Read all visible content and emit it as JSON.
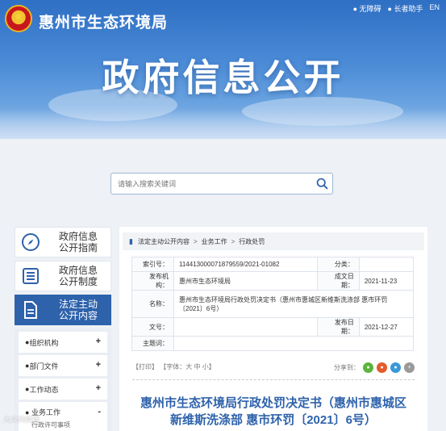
{
  "header": {
    "site_title": "惠州市生态环境局",
    "links": [
      "无障碍",
      "长者助手",
      "EN"
    ],
    "banner_text": "政府信息公开"
  },
  "search": {
    "placeholder": "请输入搜索关键词"
  },
  "left_menu": {
    "items": [
      {
        "label_line1": "政府信息",
        "label_line2": "公开指南",
        "icon": "compass-icon",
        "active": false
      },
      {
        "label_line1": "政府信息",
        "label_line2": "公开制度",
        "icon": "list-icon",
        "active": false
      },
      {
        "label_line1": "法定主动",
        "label_line2": "公开内容",
        "icon": "document-icon",
        "active": true
      }
    ],
    "sub_items": [
      {
        "label": "组织机构",
        "toggle": "+"
      },
      {
        "label": "部门文件",
        "toggle": "+"
      },
      {
        "label": "工作动态",
        "toggle": "+"
      },
      {
        "label": "业务工作",
        "toggle": "-",
        "child": "行政许可事项"
      }
    ]
  },
  "breadcrumb": [
    "法定主动公开内容",
    "业务工作",
    "行政处罚"
  ],
  "info": {
    "index_label": "索引号：",
    "index_value": "114413000071879559/2021-01082",
    "category_label": "分类：",
    "category_value": "",
    "publisher_label": "发布机构：",
    "publisher_value": "惠州市生态环境局",
    "created_label": "成文日期：",
    "created_value": "2021-11-23",
    "name_label": "名称：",
    "name_value": "惠州市生态环境局行政处罚决定书（惠州市惠城区新维斯洗涤部 惠市环罚〔2021〕6号）",
    "docno_label": "文号：",
    "docno_value": "",
    "published_label": "发布日期：",
    "published_value": "2021-12-27",
    "keywords_label": "主题词：",
    "keywords_value": ""
  },
  "tools": {
    "print": "【打印】",
    "font_label": "【字体：",
    "font_large": "大",
    "font_medium": "中",
    "font_small": "小",
    "font_end": "】",
    "share_label": "分享到："
  },
  "document": {
    "title_line1": "惠州市生态环境局行政处罚决定书（惠州市惠城区",
    "title_line2": "新维斯洗涤部 惠市环罚〔2021〕6号）"
  },
  "watermark": "大众网微博",
  "colors": {
    "primary": "#2e62ab",
    "banner": "#4a8ad6"
  }
}
